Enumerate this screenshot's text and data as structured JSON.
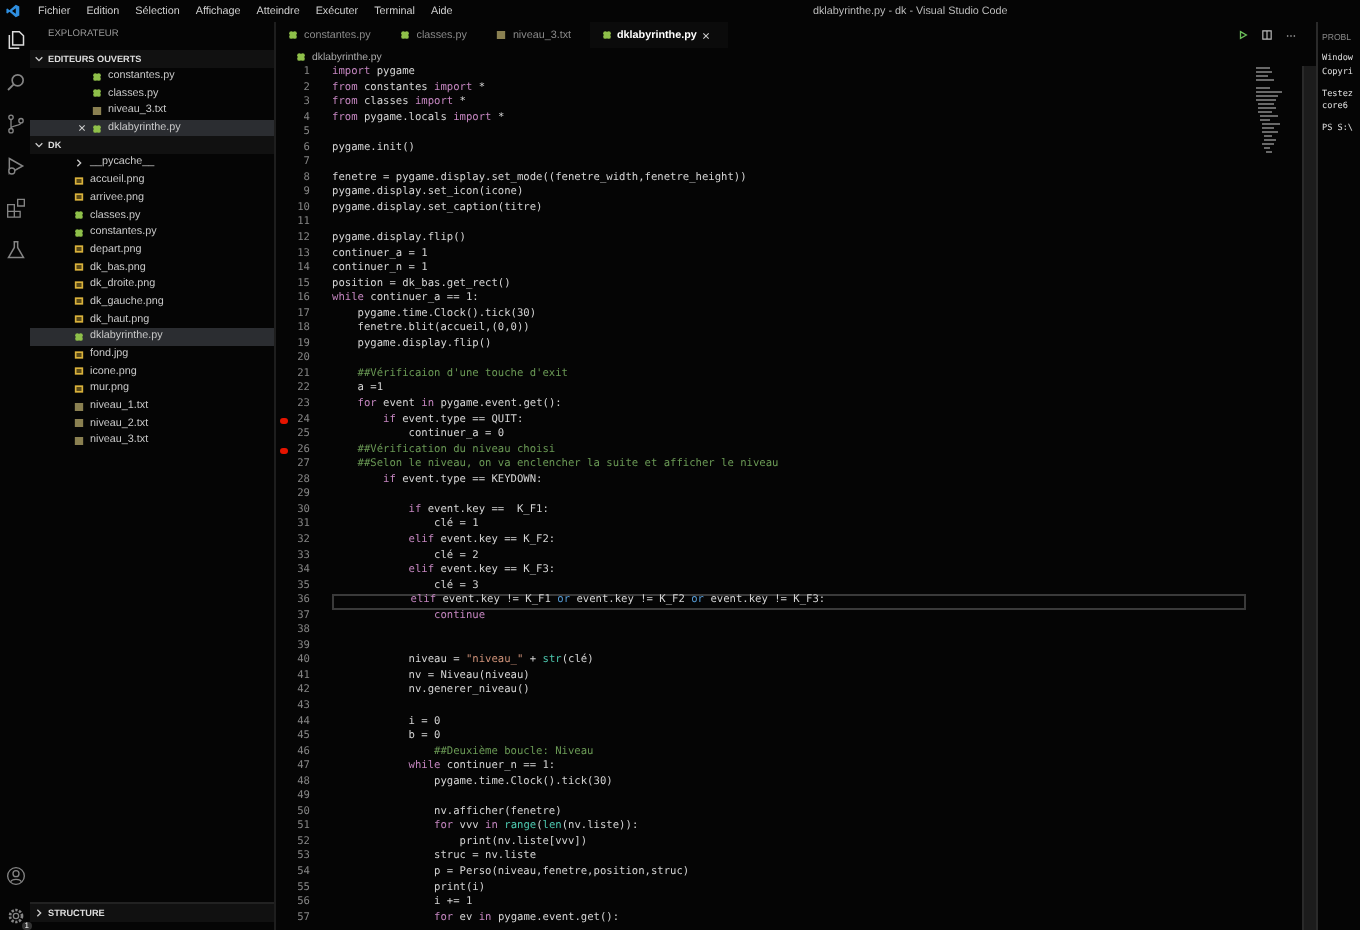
{
  "menu": [
    "Fichier",
    "Edition",
    "Sélection",
    "Affichage",
    "Atteindre",
    "Exécuter",
    "Terminal",
    "Aide"
  ],
  "window": {
    "title": "dklabyrinthe.py - dk - Visual Studio Code"
  },
  "activity_bar": {
    "settings_badge": "1"
  },
  "sidebar": {
    "title": "EXPLORATEUR",
    "sections": [
      {
        "label": "EDITEURS OUVERTS",
        "kind": "open_editors",
        "expanded": true,
        "items": [
          {
            "name": "constantes.py",
            "kind": "py",
            "selected": false
          },
          {
            "name": "classes.py",
            "kind": "py",
            "selected": false
          },
          {
            "name": "niveau_3.txt",
            "kind": "txt",
            "selected": false
          },
          {
            "name": "dklabyrinthe.py",
            "kind": "py",
            "selected": true
          }
        ]
      },
      {
        "label": "DK",
        "kind": "folder",
        "expanded": true,
        "items": [
          {
            "name": "__pycache__",
            "kind": "folder",
            "selected": false,
            "expanded": false
          },
          {
            "name": "accueil.png",
            "kind": "png",
            "selected": false
          },
          {
            "name": "arrivee.png",
            "kind": "png",
            "selected": false
          },
          {
            "name": "classes.py",
            "kind": "py",
            "selected": false
          },
          {
            "name": "constantes.py",
            "kind": "py",
            "selected": false
          },
          {
            "name": "depart.png",
            "kind": "png",
            "selected": false
          },
          {
            "name": "dk_bas.png",
            "kind": "png",
            "selected": false
          },
          {
            "name": "dk_droite.png",
            "kind": "png",
            "selected": false
          },
          {
            "name": "dk_gauche.png",
            "kind": "png",
            "selected": false
          },
          {
            "name": "dk_haut.png",
            "kind": "png",
            "selected": false
          },
          {
            "name": "dklabyrinthe.py",
            "kind": "py",
            "selected": true
          },
          {
            "name": "fond.jpg",
            "kind": "png",
            "selected": false
          },
          {
            "name": "icone.png",
            "kind": "png",
            "selected": false
          },
          {
            "name": "mur.png",
            "kind": "png",
            "selected": false
          },
          {
            "name": "niveau_1.txt",
            "kind": "txt",
            "selected": false
          },
          {
            "name": "niveau_2.txt",
            "kind": "txt",
            "selected": false
          },
          {
            "name": "niveau_3.txt",
            "kind": "txt",
            "selected": false
          }
        ]
      }
    ],
    "footer_sections": [
      {
        "label": "STRUCTURE",
        "expanded": false
      }
    ]
  },
  "tabs": [
    {
      "label": "constantes.py",
      "kind": "py",
      "selected": false
    },
    {
      "label": "classes.py",
      "kind": "py",
      "selected": false
    },
    {
      "label": "niveau_3.txt",
      "kind": "txt",
      "selected": false
    },
    {
      "label": "dklabyrinthe.py",
      "kind": "py",
      "selected": true
    }
  ],
  "breadcrumb": {
    "file": "dklabyrinthe.py",
    "kind": "py"
  },
  "lines": [
    {
      "number": "1",
      "breakpoint": false,
      "current": false,
      "segments": [
        {
          "t": "import",
          "kind": "kw"
        },
        {
          "t": " pygame",
          "kind": "plain"
        }
      ]
    },
    {
      "number": "2",
      "breakpoint": false,
      "current": false,
      "segments": [
        {
          "t": "from",
          "kind": "kw"
        },
        {
          "t": " constantes ",
          "kind": "plain"
        },
        {
          "t": "import",
          "kind": "kw"
        },
        {
          "t": " *",
          "kind": "plain"
        }
      ]
    },
    {
      "number": "3",
      "breakpoint": false,
      "current": false,
      "segments": [
        {
          "t": "from",
          "kind": "kw"
        },
        {
          "t": " classes ",
          "kind": "plain"
        },
        {
          "t": "import",
          "kind": "kw"
        },
        {
          "t": " *",
          "kind": "plain"
        }
      ]
    },
    {
      "number": "4",
      "breakpoint": false,
      "current": false,
      "segments": [
        {
          "t": "from",
          "kind": "kw"
        },
        {
          "t": " pygame.locals ",
          "kind": "plain"
        },
        {
          "t": "import",
          "kind": "kw"
        },
        {
          "t": " *",
          "kind": "plain"
        }
      ]
    },
    {
      "number": "5",
      "breakpoint": false,
      "current": false
    },
    {
      "number": "6",
      "breakpoint": false,
      "current": false,
      "segments": [
        {
          "t": "pygame.init()",
          "kind": "plain"
        }
      ]
    },
    {
      "number": "7",
      "breakpoint": false,
      "current": false
    },
    {
      "number": "8",
      "breakpoint": false,
      "current": false,
      "segments": [
        {
          "t": "fenetre = pygame.display.set_mode((fenetre_width,fenetre_height))",
          "kind": "plain"
        }
      ]
    },
    {
      "number": "9",
      "breakpoint": false,
      "current": false,
      "segments": [
        {
          "t": "pygame.display.set_icon(icone)",
          "kind": "plain"
        }
      ]
    },
    {
      "number": "10",
      "breakpoint": false,
      "current": false,
      "segments": [
        {
          "t": "pygame.display.set_caption(titre)",
          "kind": "plain"
        }
      ]
    },
    {
      "number": "11",
      "breakpoint": false,
      "current": false
    },
    {
      "number": "12",
      "breakpoint": false,
      "current": false,
      "segments": [
        {
          "t": "pygame.display.flip()",
          "kind": "plain"
        }
      ]
    },
    {
      "number": "13",
      "breakpoint": false,
      "current": false,
      "segments": [
        {
          "t": "continuer_a = 1",
          "kind": "plain"
        }
      ]
    },
    {
      "number": "14",
      "breakpoint": false,
      "current": false,
      "segments": [
        {
          "t": "continuer_n = 1",
          "kind": "plain"
        }
      ]
    },
    {
      "number": "15",
      "breakpoint": false,
      "current": false,
      "segments": [
        {
          "t": "position = dk_bas.get_rect()",
          "kind": "plain"
        }
      ]
    },
    {
      "number": "16",
      "breakpoint": false,
      "current": false,
      "segments": [
        {
          "t": "while",
          "kind": "kw"
        },
        {
          "t": " continuer_a == 1:",
          "kind": "plain"
        }
      ]
    },
    {
      "number": "17",
      "breakpoint": false,
      "current": false,
      "segments": [
        {
          "t": "    pygame.time.Clock().tick(30)",
          "kind": "plain"
        }
      ]
    },
    {
      "number": "18",
      "breakpoint": false,
      "current": false,
      "segments": [
        {
          "t": "    fenetre.blit(accueil,(0,0))",
          "kind": "plain"
        }
      ]
    },
    {
      "number": "19",
      "breakpoint": false,
      "current": false,
      "segments": [
        {
          "t": "    pygame.display.flip()",
          "kind": "plain"
        }
      ]
    },
    {
      "number": "20",
      "breakpoint": false,
      "current": false
    },
    {
      "number": "21",
      "breakpoint": false,
      "current": false,
      "segments": [
        {
          "t": "    ##Vérificaion d'une touche d'exit",
          "kind": "comment"
        }
      ]
    },
    {
      "number": "22",
      "breakpoint": false,
      "current": false,
      "segments": [
        {
          "t": "    a =1",
          "kind": "plain"
        }
      ]
    },
    {
      "number": "23",
      "breakpoint": false,
      "current": false,
      "segments": [
        {
          "t": "    for",
          "kind": "kw"
        },
        {
          "t": " event ",
          "kind": "plain"
        },
        {
          "t": "in",
          "kind": "kw"
        },
        {
          "t": " pygame.event.get():",
          "kind": "plain"
        }
      ]
    },
    {
      "number": "24",
      "breakpoint": true,
      "current": false,
      "segments": [
        {
          "t": "        if",
          "kind": "kw"
        },
        {
          "t": " event.type == QUIT:",
          "kind": "plain"
        }
      ]
    },
    {
      "number": "25",
      "breakpoint": false,
      "current": false,
      "segments": [
        {
          "t": "            continuer_a = 0",
          "kind": "plain"
        }
      ]
    },
    {
      "number": "26",
      "breakpoint": true,
      "current": false,
      "segments": [
        {
          "t": "    ##Vérification du niveau choisi",
          "kind": "comment"
        }
      ]
    },
    {
      "number": "27",
      "breakpoint": false,
      "current": false,
      "segments": [
        {
          "t": "    ##Selon le niveau, on va enclencher la suite et afficher le niveau",
          "kind": "comment"
        }
      ]
    },
    {
      "number": "28",
      "breakpoint": false,
      "current": false,
      "segments": [
        {
          "t": "        if",
          "kind": "kw"
        },
        {
          "t": " event.type == KEYDOWN:",
          "kind": "plain"
        }
      ]
    },
    {
      "number": "29",
      "breakpoint": false,
      "current": false
    },
    {
      "number": "30",
      "breakpoint": false,
      "current": false,
      "segments": [
        {
          "t": "            if",
          "kind": "kw"
        },
        {
          "t": " event.key ==  K_F1:",
          "kind": "plain"
        }
      ]
    },
    {
      "number": "31",
      "breakpoint": false,
      "current": false,
      "segments": [
        {
          "t": "                clé = 1",
          "kind": "plain"
        }
      ]
    },
    {
      "number": "32",
      "breakpoint": false,
      "current": false,
      "segments": [
        {
          "t": "            elif",
          "kind": "kw"
        },
        {
          "t": " event.key == K_F2:",
          "kind": "plain"
        }
      ]
    },
    {
      "number": "33",
      "breakpoint": false,
      "current": false,
      "segments": [
        {
          "t": "                clé = 2",
          "kind": "plain"
        }
      ]
    },
    {
      "number": "34",
      "breakpoint": false,
      "current": false,
      "segments": [
        {
          "t": "            elif",
          "kind": "kw"
        },
        {
          "t": " event.key == K_F3:",
          "kind": "plain"
        }
      ]
    },
    {
      "number": "35",
      "breakpoint": false,
      "current": false,
      "segments": [
        {
          "t": "                clé = 3",
          "kind": "plain"
        }
      ]
    },
    {
      "number": "36",
      "breakpoint": false,
      "current": true,
      "segments": [
        {
          "t": "            elif",
          "kind": "kw"
        },
        {
          "t": " event.key != K_F1 ",
          "kind": "plain"
        },
        {
          "t": "or",
          "kind": "op"
        },
        {
          "t": " event.key != K_F2 ",
          "kind": "plain"
        },
        {
          "t": "or",
          "kind": "op"
        },
        {
          "t": " event.key != K_F3:",
          "kind": "plain"
        }
      ]
    },
    {
      "number": "37",
      "breakpoint": false,
      "current": false,
      "segments": [
        {
          "t": "                continue",
          "kind": "kw"
        }
      ]
    },
    {
      "number": "38",
      "breakpoint": false,
      "current": false
    },
    {
      "number": "39",
      "breakpoint": false,
      "current": false
    },
    {
      "number": "40",
      "breakpoint": false,
      "current": false,
      "segments": [
        {
          "t": "            niveau = ",
          "kind": "plain"
        },
        {
          "t": "\"niveau_\"",
          "kind": "str"
        },
        {
          "t": " + ",
          "kind": "plain"
        },
        {
          "t": "str",
          "kind": "builtin"
        },
        {
          "t": "(clé)",
          "kind": "plain"
        }
      ]
    },
    {
      "number": "41",
      "breakpoint": false,
      "current": false,
      "segments": [
        {
          "t": "            nv = Niveau(niveau)",
          "kind": "plain"
        }
      ]
    },
    {
      "number": "42",
      "breakpoint": false,
      "current": false,
      "segments": [
        {
          "t": "            nv.generer_niveau()",
          "kind": "plain"
        }
      ]
    },
    {
      "number": "43",
      "breakpoint": false,
      "current": false
    },
    {
      "number": "44",
      "breakpoint": false,
      "current": false,
      "segments": [
        {
          "t": "            i = 0",
          "kind": "plain"
        }
      ]
    },
    {
      "number": "45",
      "breakpoint": false,
      "current": false,
      "segments": [
        {
          "t": "            b = 0",
          "kind": "plain"
        }
      ]
    },
    {
      "number": "46",
      "breakpoint": false,
      "current": false,
      "segments": [
        {
          "t": "                ##Deuxième boucle: Niveau",
          "kind": "comment"
        }
      ]
    },
    {
      "number": "47",
      "breakpoint": false,
      "current": false,
      "segments": [
        {
          "t": "            while",
          "kind": "kw"
        },
        {
          "t": " continuer_n == 1:",
          "kind": "plain"
        }
      ]
    },
    {
      "number": "48",
      "breakpoint": false,
      "current": false,
      "segments": [
        {
          "t": "                pygame.time.Clock().tick(30)",
          "kind": "plain"
        }
      ]
    },
    {
      "number": "49",
      "breakpoint": false,
      "current": false
    },
    {
      "number": "50",
      "breakpoint": false,
      "current": false,
      "segments": [
        {
          "t": "                nv.afficher(fenetre)",
          "kind": "plain"
        }
      ]
    },
    {
      "number": "51",
      "breakpoint": false,
      "current": false,
      "segments": [
        {
          "t": "                for",
          "kind": "kw"
        },
        {
          "t": " vvv ",
          "kind": "plain"
        },
        {
          "t": "in",
          "kind": "kw"
        },
        {
          "t": " range",
          "kind": "builtin"
        },
        {
          "t": "(",
          "kind": "plain"
        },
        {
          "t": "len",
          "kind": "builtin"
        },
        {
          "t": "(nv.liste)):",
          "kind": "plain"
        }
      ]
    },
    {
      "number": "52",
      "breakpoint": false,
      "current": false,
      "segments": [
        {
          "t": "                    print(nv.liste[vvv])",
          "kind": "plain"
        }
      ]
    },
    {
      "number": "53",
      "breakpoint": false,
      "current": false,
      "segments": [
        {
          "t": "                struc = nv.liste",
          "kind": "plain"
        }
      ]
    },
    {
      "number": "54",
      "breakpoint": false,
      "current": false,
      "segments": [
        {
          "t": "                p = Perso(niveau,fenetre,position,struc)",
          "kind": "plain"
        }
      ]
    },
    {
      "number": "55",
      "breakpoint": false,
      "current": false,
      "segments": [
        {
          "t": "                print(i)",
          "kind": "plain"
        }
      ]
    },
    {
      "number": "56",
      "breakpoint": false,
      "current": false,
      "segments": [
        {
          "t": "                i += 1",
          "kind": "plain"
        }
      ]
    },
    {
      "number": "57",
      "breakpoint": false,
      "current": false,
      "segments": [
        {
          "t": "                for",
          "kind": "kw"
        },
        {
          "t": " ev ",
          "kind": "plain"
        },
        {
          "t": "in",
          "kind": "kw"
        },
        {
          "t": " pygame.event.get():",
          "kind": "plain"
        }
      ]
    }
  ],
  "panel": {
    "tab": "PROBL",
    "blocks": [
      [
        "Window",
        "Copyri"
      ],
      [
        "Testez",
        "core6"
      ],
      [
        "PS S:\\"
      ]
    ]
  }
}
